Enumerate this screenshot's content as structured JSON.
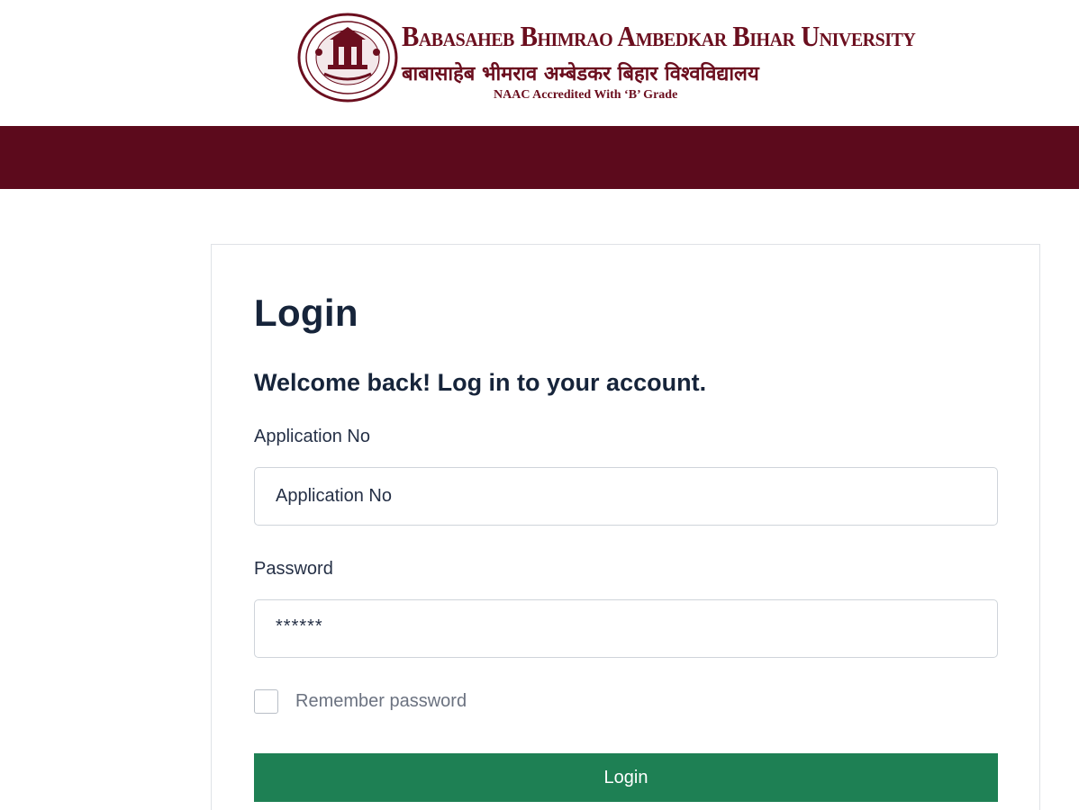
{
  "header": {
    "brand_title": "Babasaheb Bhimrao Ambedkar Bihar University",
    "brand_hindi": "बाबासाहेब भीमराव अम्बेडकर बिहार विश्वविद्यालय",
    "accreditation": "NAAC Accredited With ‘B’ Grade",
    "seal_text": "BABASAHEB BHIMRAO AMBEDKAR BIHAR UNIVERSITY",
    "brand_color": "#6b0e1e",
    "band_color": "#5c0a1c"
  },
  "login": {
    "title": "Login",
    "welcome": "Welcome back! Log in to your account.",
    "application_label": "Application No",
    "application_value": "Application No",
    "password_label": "Password",
    "password_value": "******",
    "remember_label": "Remember password",
    "remember_checked": false,
    "button_label": "Login",
    "button_color": "#1e8054"
  }
}
